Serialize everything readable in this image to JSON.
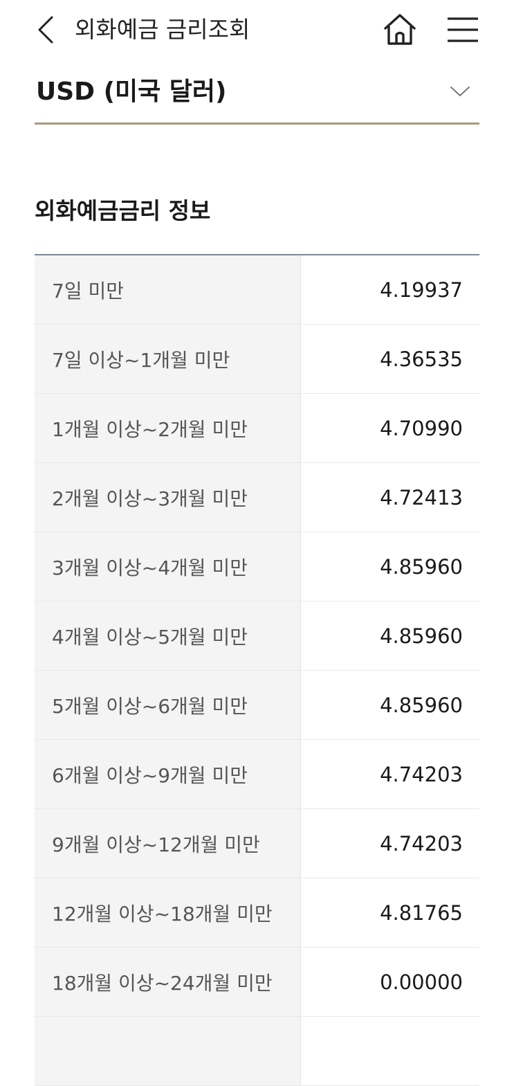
{
  "header": {
    "title": "외화예금 금리조회",
    "back_icon": "chevron-left-icon",
    "home_icon": "home-icon",
    "menu_icon": "hamburger-menu-icon"
  },
  "currency_select": {
    "selected": "USD (미국 달러)",
    "icon": "chevron-down-icon"
  },
  "section": {
    "title": "외화예금금리 정보"
  },
  "rates": [
    {
      "period": "7일 미만",
      "rate": "4.19937"
    },
    {
      "period": "7일 이상~1개월 미만",
      "rate": "4.36535"
    },
    {
      "period": "1개월 이상~2개월 미만",
      "rate": "4.70990"
    },
    {
      "period": "2개월 이상~3개월 미만",
      "rate": "4.72413"
    },
    {
      "period": "3개월 이상~4개월 미만",
      "rate": "4.85960"
    },
    {
      "period": "4개월 이상~5개월 미만",
      "rate": "4.85960"
    },
    {
      "period": "5개월 이상~6개월 미만",
      "rate": "4.85960"
    },
    {
      "period": "6개월 이상~9개월 미만",
      "rate": "4.74203"
    },
    {
      "period": "9개월 이상~12개월 미만",
      "rate": "4.74203"
    },
    {
      "period": "12개월 이상~18개월 미만",
      "rate": "4.81765"
    },
    {
      "period": "18개월 이상~24개월 미만",
      "rate": "0.00000"
    },
    {
      "period": "",
      "rate": ""
    }
  ],
  "colors": {
    "accent_underline": "#a89b7c",
    "table_top_border": "#7f8794",
    "period_cell_bg": "#f4f4f5"
  }
}
